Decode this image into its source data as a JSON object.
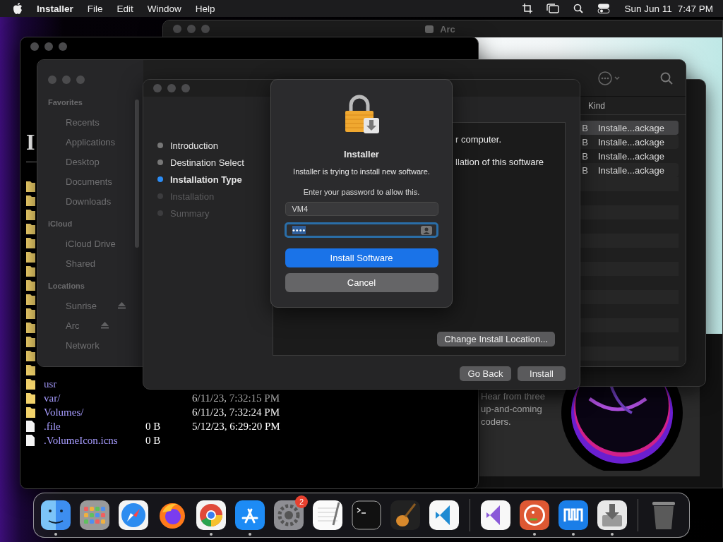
{
  "menu_bar": {
    "app": "Installer",
    "items": [
      "File",
      "Edit",
      "Window",
      "Help"
    ],
    "date": "Sun Jun 11",
    "time": "7:47 PM"
  },
  "browser_window": {
    "heading": "I",
    "rows": [
      {
        "kind": "folder"
      },
      {
        "kind": "folder"
      },
      {
        "kind": "folder"
      },
      {
        "kind": "folder"
      },
      {
        "kind": "folder"
      },
      {
        "kind": "folder"
      },
      {
        "kind": "folder"
      },
      {
        "kind": "folder"
      },
      {
        "kind": "folder"
      },
      {
        "kind": "folder"
      },
      {
        "kind": "folder"
      },
      {
        "kind": "folder"
      },
      {
        "kind": "folder"
      },
      {
        "kind": "folder"
      },
      {
        "kind": "folder",
        "name": "usr"
      },
      {
        "kind": "folder",
        "name": "var/",
        "date": "6/11/23, 7:32:15 PM"
      },
      {
        "kind": "folder",
        "name": "Volumes/",
        "date": "6/11/23, 7:32:24 PM"
      },
      {
        "kind": "file",
        "name": ".file",
        "size": "0 B",
        "date": "5/12/23, 6:29:20 PM"
      },
      {
        "kind": "file",
        "name": ".VolumeIcon.icns",
        "size": "0 B"
      }
    ]
  },
  "arc_window": {
    "title": "Arc",
    "card_text": "Hear from three up-and-coming coders."
  },
  "finder_window": {
    "sidebar": [
      {
        "heading": "Favorites",
        "items": [
          {
            "label": "Recents",
            "ejectable": false
          },
          {
            "label": "Applications",
            "ejectable": false
          },
          {
            "label": "Desktop",
            "ejectable": false
          },
          {
            "label": "Documents",
            "ejectable": false
          },
          {
            "label": "Downloads",
            "ejectable": false
          }
        ]
      },
      {
        "heading": "iCloud",
        "items": [
          {
            "label": "iCloud Drive",
            "ejectable": false
          },
          {
            "label": "Shared",
            "ejectable": false
          }
        ]
      },
      {
        "heading": "Locations",
        "items": [
          {
            "label": "Sunrise",
            "ejectable": true
          },
          {
            "label": "Arc",
            "ejectable": true
          },
          {
            "label": "Network",
            "ejectable": false
          }
        ]
      }
    ],
    "columns": [
      "Kind"
    ],
    "rows": [
      {
        "size": "B",
        "kind": "Installe...ackage",
        "selected": true
      },
      {
        "size": "B",
        "kind": "Installe...ackage",
        "selected": false
      },
      {
        "size": "B",
        "kind": "Installe...ackage",
        "selected": false
      },
      {
        "size": "B",
        "kind": "Installe...ackage",
        "selected": false
      }
    ]
  },
  "installer_window": {
    "steps": [
      {
        "label": "Introduction",
        "completed": true,
        "current": false
      },
      {
        "label": "Destination Select",
        "completed": true,
        "current": false
      },
      {
        "label": "Installation Type",
        "completed": false,
        "current": true
      },
      {
        "label": "Installation",
        "completed": false,
        "current": false
      },
      {
        "label": "Summary",
        "completed": false,
        "current": false
      }
    ],
    "content": [
      "r computer.",
      "llation of this software"
    ],
    "change_location": "Change Install Location...",
    "buttons": [
      "Go Back",
      "Install"
    ]
  },
  "dialog": {
    "title": "Installer",
    "message": "Installer is trying to install new software.",
    "prompt": "Enter your password to allow this.",
    "username": "VM4",
    "password": {
      "value": "••••",
      "focused": true,
      "text_selected": true
    },
    "buttons": [
      {
        "label": "Install Software",
        "kind": "primary"
      },
      {
        "label": "Cancel",
        "kind": "secondary"
      }
    ]
  },
  "dock": [
    {
      "kind": "finder",
      "running": true
    },
    {
      "kind": "launchpad",
      "running": false
    },
    {
      "kind": "safari",
      "running": false
    },
    {
      "kind": "firefox",
      "running": false
    },
    {
      "kind": "chrome",
      "running": true
    },
    {
      "kind": "appstore",
      "running": true
    },
    {
      "kind": "settings",
      "running": false,
      "badge": "2"
    },
    {
      "kind": "textedit",
      "running": false
    },
    {
      "kind": "terminal",
      "running": false
    },
    {
      "kind": "guitar",
      "running": false
    },
    {
      "kind": "vscode",
      "running": false
    },
    {
      "kind": "divider"
    },
    {
      "kind": "vstudio",
      "running": false
    },
    {
      "kind": "duck",
      "running": true
    },
    {
      "kind": "maxthon",
      "running": true
    },
    {
      "kind": "installer",
      "running": true
    },
    {
      "kind": "divider"
    },
    {
      "kind": "trash",
      "running": false
    }
  ]
}
